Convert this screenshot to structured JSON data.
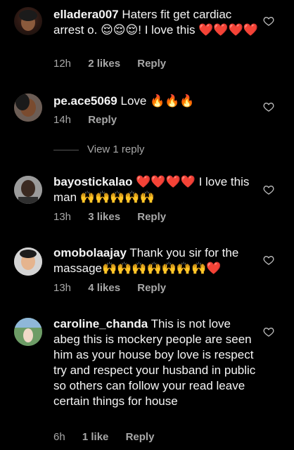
{
  "comments": [
    {
      "username": "elladera007",
      "text": "Haters fit get cardiac arrest o. 😌😌😌! I love this ❤️❤️❤️❤️",
      "time": "12h",
      "likes": "2 likes",
      "reply_label": "Reply"
    },
    {
      "username": "pe.ace5069",
      "text": "Love 🔥🔥🔥",
      "time": "14h",
      "reply_label": "Reply",
      "view_replies": "View 1 reply"
    },
    {
      "username": "bayostickalao",
      "text": "❤️❤️❤️❤️ I love this man 🙌🙌🙌🙌🙌",
      "time": "13h",
      "likes": "3 likes",
      "reply_label": "Reply"
    },
    {
      "username": "omobolaajay",
      "text": "Thank you sir for the massage🙌🙌🙌🙌🙌🙌🙌❤️",
      "time": "13h",
      "likes": "4 likes",
      "reply_label": "Reply"
    },
    {
      "username": "caroline_chanda",
      "text": "This is not love abeg this is mockery people are seen him as your house boy love is respect try and respect your husband in public so others can follow your read leave certain things for house",
      "time": "6h",
      "likes": "1 like",
      "reply_label": "Reply"
    }
  ],
  "colors": {
    "background": "#000000",
    "text": "#f5f5f5",
    "meta": "#a8a8a8"
  },
  "icons": {
    "heart": "heart-outline-icon"
  }
}
